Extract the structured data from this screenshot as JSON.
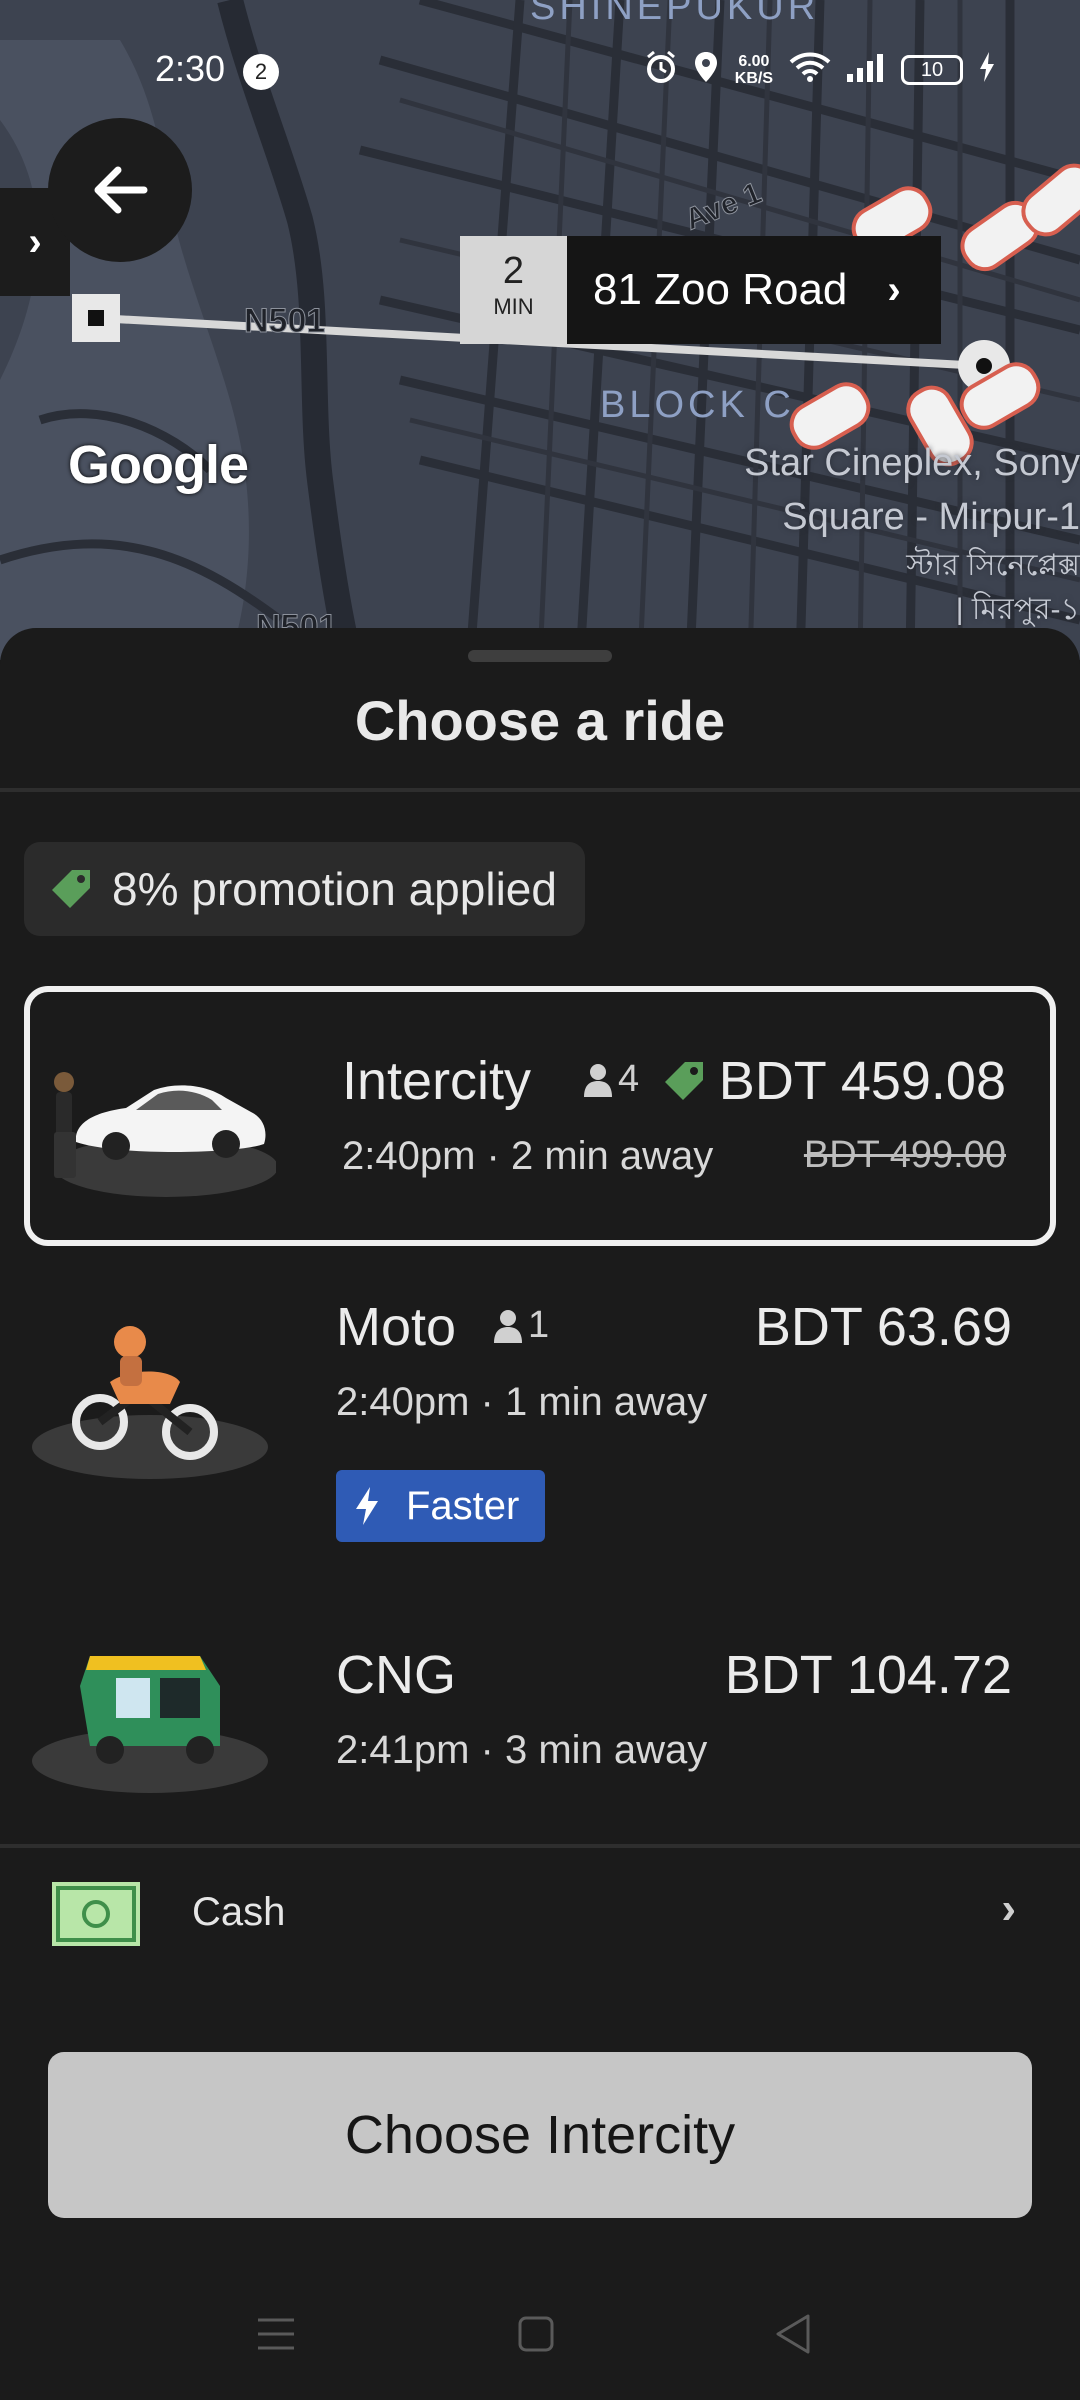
{
  "status_bar": {
    "time": "2:30",
    "notification_count": "2",
    "net_speed_value": "6.00",
    "net_speed_unit": "KB/S",
    "battery": "10"
  },
  "map": {
    "area_label_top": "SHINEPUKUR",
    "area_label_block": "BLOCK C",
    "road_label_1": "Ave 1",
    "road_label_2": "N501",
    "road_label_3": "N501",
    "poi_line_1": "Star Cineplex, Sony",
    "poi_line_2": "Square - Mirpur-1",
    "poi_line_3": "স্টার সিনেপ্লেক্স",
    "poi_line_4": "| মিরপুর-১",
    "google_logo": "Google",
    "eta_minutes": "2",
    "eta_unit": "MIN",
    "destination": "81 Zoo Road"
  },
  "sheet": {
    "title": "Choose a ride",
    "promotion": "8% promotion applied"
  },
  "rides": [
    {
      "name": "Intercity",
      "capacity": "4",
      "price": "BDT 459.08",
      "original_price": "BDT 499.00",
      "eta": "2:40pm · 2 min away",
      "selected": true
    },
    {
      "name": "Moto",
      "capacity": "1",
      "price": "BDT 63.69",
      "eta": "2:40pm · 1 min away",
      "badge": "Faster"
    },
    {
      "name": "CNG",
      "price": "BDT 104.72",
      "eta": "2:41pm · 3 min away"
    }
  ],
  "payment": {
    "method": "Cash"
  },
  "cta": {
    "label": "Choose Intercity"
  },
  "colors": {
    "promo_tag": "#5a9e5a",
    "faster_badge": "#2f5bb5",
    "cta_background": "#c6c6c6",
    "map_background": "#3d4350"
  }
}
